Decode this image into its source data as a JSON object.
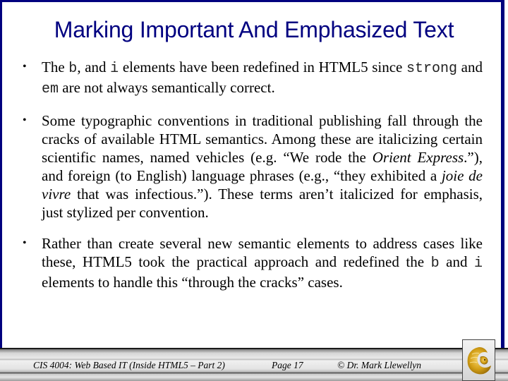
{
  "slide": {
    "title": "Marking Important And Emphasized Text",
    "bullets": [
      {
        "segments": [
          {
            "text": "The ",
            "style": "normal"
          },
          {
            "text": "b",
            "style": "mono"
          },
          {
            "text": ", and ",
            "style": "normal"
          },
          {
            "text": "i",
            "style": "mono"
          },
          {
            "text": " elements have been redefined in HTML5 since ",
            "style": "normal"
          },
          {
            "text": "strong",
            "style": "mono"
          },
          {
            "text": " and ",
            "style": "normal"
          },
          {
            "text": "em",
            "style": "mono"
          },
          {
            "text": " are not always semantically correct.",
            "style": "normal"
          }
        ]
      },
      {
        "segments": [
          {
            "text": "Some typographic conventions in traditional publishing fall through the cracks of available HTML semantics.  Among these are italicizing certain scientific names, named vehicles (e.g. “We rode the ",
            "style": "normal"
          },
          {
            "text": "Orient Express",
            "style": "italic"
          },
          {
            "text": ".”), and foreign (to English) language phrases (e.g., “they exhibited a ",
            "style": "normal"
          },
          {
            "text": "joie de vivre",
            "style": "italic"
          },
          {
            "text": " that was infectious.”).  These terms aren’t italicized for emphasis, just stylized per convention.",
            "style": "normal"
          }
        ]
      },
      {
        "segments": [
          {
            "text": "Rather than create several new semantic elements to address cases like these, HTML5 took the practical approach and redefined the ",
            "style": "normal"
          },
          {
            "text": "b",
            "style": "mono"
          },
          {
            "text": "  and ",
            "style": "normal"
          },
          {
            "text": "i",
            "style": "mono"
          },
          {
            "text": " elements to handle this “through the cracks” cases.",
            "style": "normal"
          }
        ]
      }
    ],
    "bullet_glyph": "•"
  },
  "footer": {
    "course": "CIS 4004: Web Based IT (Inside HTML5 – Part 2)",
    "page": "Page 17",
    "copyright": "© Dr. Mark Llewellyn",
    "logo_icon": "pegasus-logo-icon"
  },
  "colors": {
    "title": "#000080",
    "frame": "#00007f",
    "logo_gold": "#d4a017"
  }
}
